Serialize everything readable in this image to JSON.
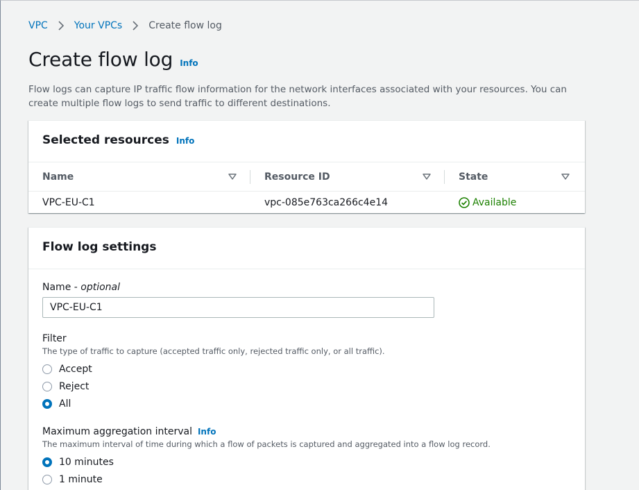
{
  "breadcrumb": {
    "items": [
      {
        "label": "VPC"
      },
      {
        "label": "Your VPCs"
      }
    ],
    "current": "Create flow log"
  },
  "page": {
    "title": "Create flow log",
    "info": "Info",
    "description": "Flow logs can capture IP traffic flow information for the network interfaces associated with your resources. You can create multiple flow logs to send traffic to different destinations."
  },
  "resources": {
    "title": "Selected resources",
    "info": "Info",
    "columns": [
      "Name",
      "Resource ID",
      "State"
    ],
    "rows": [
      {
        "name": "VPC-EU-C1",
        "resource_id": "vpc-085e763ca266c4e14",
        "state": "Available"
      }
    ]
  },
  "settings": {
    "title": "Flow log settings",
    "name_field": {
      "label": "Name - ",
      "label_optional": "optional",
      "value": "VPC-EU-C1"
    },
    "filter": {
      "label": "Filter",
      "description": "The type of traffic to capture (accepted traffic only, rejected traffic only, or all traffic).",
      "options": [
        "Accept",
        "Reject",
        "All"
      ],
      "selected": "All"
    },
    "interval": {
      "label": "Maximum aggregation interval",
      "info": "Info",
      "description": "The maximum interval of time during which a flow of packets is captured and aggregated into a flow log record.",
      "options": [
        "10 minutes",
        "1 minute"
      ],
      "selected": "10 minutes"
    }
  },
  "colors": {
    "link": "#0073bb",
    "success": "#1d8102",
    "radio_selected": "#0073bb"
  },
  "icons": {
    "breadcrumb_separator": "chevron-right-icon",
    "sort": "sort-down-icon",
    "status": "check-circle-icon"
  }
}
